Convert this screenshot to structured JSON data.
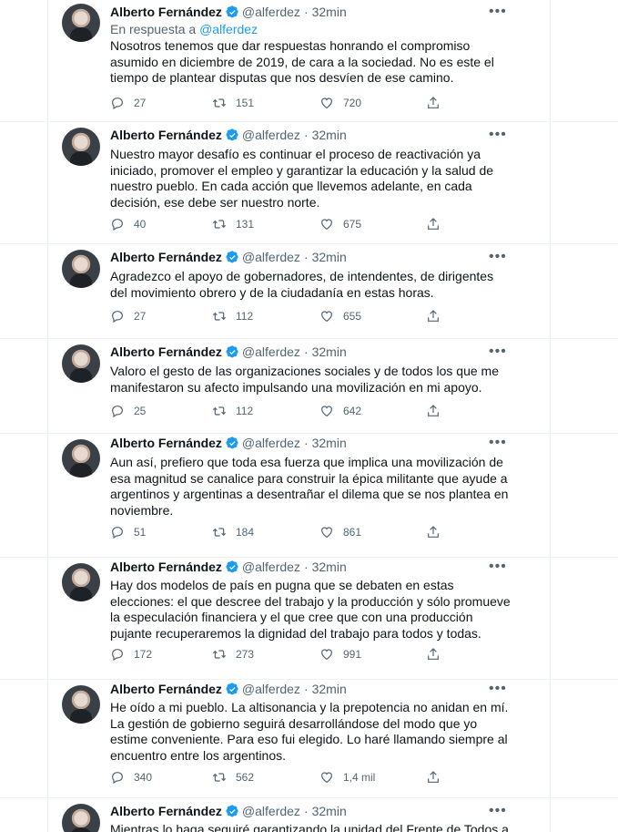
{
  "tweets": [
    {
      "name": "Alberto Fernández",
      "handle": "@alferdez",
      "time": "32min",
      "reply_prefix": "En respuesta a",
      "reply_handle": "@alferdez",
      "text": "Nosotros tenemos que dar respuestas honrando el compromiso asumido en diciembre de 2019, de cara a la sociedad. No es este el tiempo de plantear disputas que nos desvíen de ese camino.",
      "replies": "27",
      "retweets": "151",
      "likes": "720"
    },
    {
      "name": "Alberto Fernández",
      "handle": "@alferdez",
      "time": "32min",
      "text": "Nuestro mayor desafío es continuar el proceso de reactivación ya iniciado, promover el empleo y garantizar la educación y la salud de nuestro pueblo. En cada acción que llevemos adelante, en cada decisión, ese debe ser nuestro norte.",
      "replies": "40",
      "retweets": "131",
      "likes": "675"
    },
    {
      "name": "Alberto Fernández",
      "handle": "@alferdez",
      "time": "32min",
      "text": "Agradezco el apoyo de gobernadores, de intendentes, de dirigentes del movimiento obrero y de la ciudadanía en estas horas.",
      "replies": "27",
      "retweets": "112",
      "likes": "655"
    },
    {
      "name": "Alberto Fernández",
      "handle": "@alferdez",
      "time": "32min",
      "text": "Valoro el gesto de las organizaciones sociales y de todos los que me manifestaron su afecto impulsando una movilización en mi apoyo.",
      "replies": "25",
      "retweets": "112",
      "likes": "642"
    },
    {
      "name": "Alberto Fernández",
      "handle": "@alferdez",
      "time": "32min",
      "text": "Aun así, prefiero que toda esa fuerza que implica una movilización de esa magnitud se canalice para construir la épica militante que ayude a argentinos y argentinas a desentrañar el dilema que se nos plantea en noviembre.",
      "replies": "51",
      "retweets": "184",
      "likes": "861"
    },
    {
      "name": "Alberto Fernández",
      "handle": "@alferdez",
      "time": "32min",
      "text": "Hay dos modelos de país en pugna que se debaten en estas elecciones: el que descree del trabajo y la producción y sólo promueve la especulación financiera y el que cree que con una producción pujante recuperaremos la dignidad del trabajo para todos y todas.",
      "replies": "172",
      "retweets": "273",
      "likes": "991"
    },
    {
      "name": "Alberto Fernández",
      "handle": "@alferdez",
      "time": "32min",
      "text": "He oído a mi pueblo. La altisonancia y la prepotencia no anidan en mí. La gestión de gobierno seguirá desarrollándose del modo que yo estime conveniente. Para eso fui elegido. Lo haré llamando siempre al encuentro entre los argentinos.",
      "replies": "340",
      "retweets": "562",
      "likes": "1,4 mil"
    },
    {
      "name": "Alberto Fernández",
      "handle": "@alferdez",
      "time": "32min",
      "text": "Mientras lo haga seguiré garantizando la unidad del Frente de Todos a partir",
      "replies": "",
      "retweets": "",
      "likes": ""
    }
  ],
  "colors": {
    "verified": "#1d9bf0",
    "muted": "#536471",
    "link": "#1d9bf0"
  },
  "icons": [
    "verified-badge-icon",
    "more-icon",
    "reply-icon",
    "retweet-icon",
    "like-icon",
    "share-icon"
  ]
}
